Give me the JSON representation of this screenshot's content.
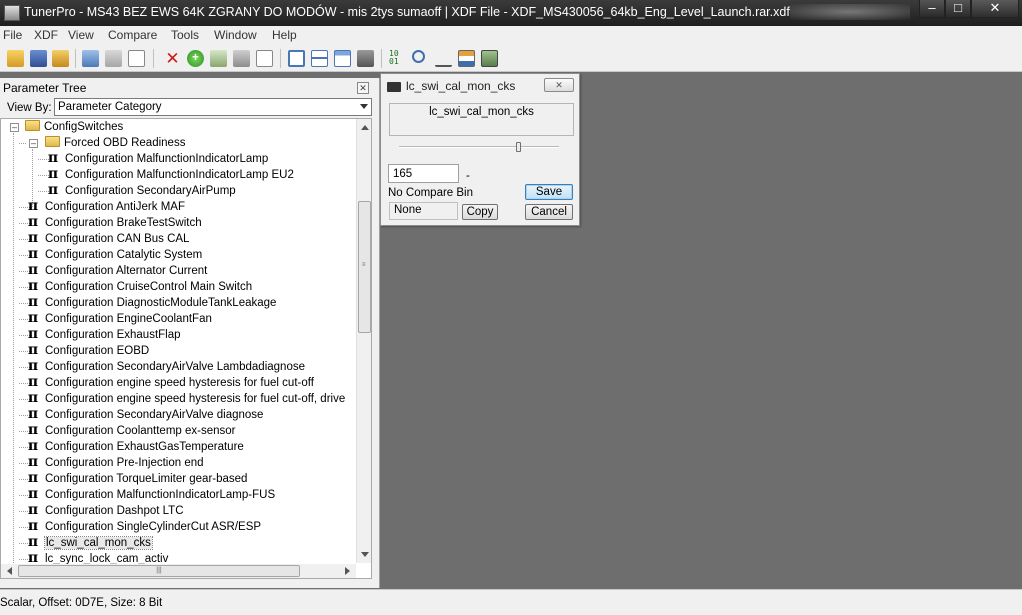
{
  "window": {
    "title": "TunerPro - MS43 BEZ EWS 64K ZGRANY DO MODÓW - mis 2tys sumaoff | XDF File - XDF_MS430056_64kb_Eng_Level_Launch.rar.xdf",
    "minimize": "–",
    "maximize": "□",
    "close": "✕"
  },
  "menu": [
    "File",
    "XDF",
    "View",
    "Compare",
    "Tools",
    "Window",
    "Help"
  ],
  "toolbar_icons": [
    "open-folder-icon",
    "save-icon",
    "open-bin-icon",
    "separator",
    "xdf-icon",
    "xdf-edit-icon",
    "new-document-icon",
    "separator",
    "delete-icon",
    "add-icon",
    "compare-icon",
    "tools-icon",
    "blank-page-icon",
    "separator",
    "window-icon",
    "layout-icon",
    "calendar-icon",
    "monitor-icon",
    "separator",
    "binary-icon",
    "search-icon",
    "scale-icon",
    "hierarchy-icon",
    "calculator-icon"
  ],
  "panel": {
    "title": "Parameter Tree",
    "close": "✕",
    "view_by_label": "View By:",
    "view_by_value": "Parameter Category"
  },
  "tree": {
    "root": "ConfigSwitches",
    "folder": "Forced OBD Readiness",
    "folder_children": [
      "Configuration MalfunctionIndicatorLamp",
      "Configuration MalfunctionIndicatorLamp EU2",
      "Configuration SecondaryAirPump"
    ],
    "items": [
      "Configuration AntiJerk MAF",
      "Configuration BrakeTestSwitch",
      "Configuration CAN Bus CAL",
      "Configuration Catalytic System",
      "Configuration Alternator Current",
      "Configuration CruiseControl Main Switch",
      "Configuration DiagnosticModuleTankLeakage",
      "Configuration EngineCoolantFan",
      "Configuration ExhaustFlap",
      "Configuration EOBD",
      "Configuration SecondaryAirValve Lambdadiagnose",
      "Configuration engine speed hysteresis for fuel cut-off",
      "Configuration engine speed hysteresis for fuel cut-off, drive",
      "Configuration SecondaryAirValve diagnose",
      "Configuration Coolanttemp ex-sensor",
      "Configuration ExhaustGasTemperature",
      "Configuration Pre-Injection end",
      "Configuration TorqueLimiter gear-based",
      "Configuration MalfunctionIndicatorLamp-FUS",
      "Configuration Dashpot LTC",
      "Configuration SingleCylinderCut ASR/ESP",
      "lc_swi_cal_mon_cks",
      "lc_sync_lock_cam_activ"
    ],
    "selected": "lc_swi_cal_mon_cks"
  },
  "dialog": {
    "title": "lc_swi_cal_mon_cks",
    "close": "✕",
    "param_name": "lc_swi_cal_mon_cks",
    "slider_level": 0.75,
    "value": "165",
    "unit": "-",
    "compare_label": "No Compare Bin",
    "compare_value": "None",
    "save_label": "Save",
    "copy_label": "Copy",
    "cancel_label": "Cancel"
  },
  "status": "Scalar, Offset: 0D7E,  Size: 8 Bit"
}
